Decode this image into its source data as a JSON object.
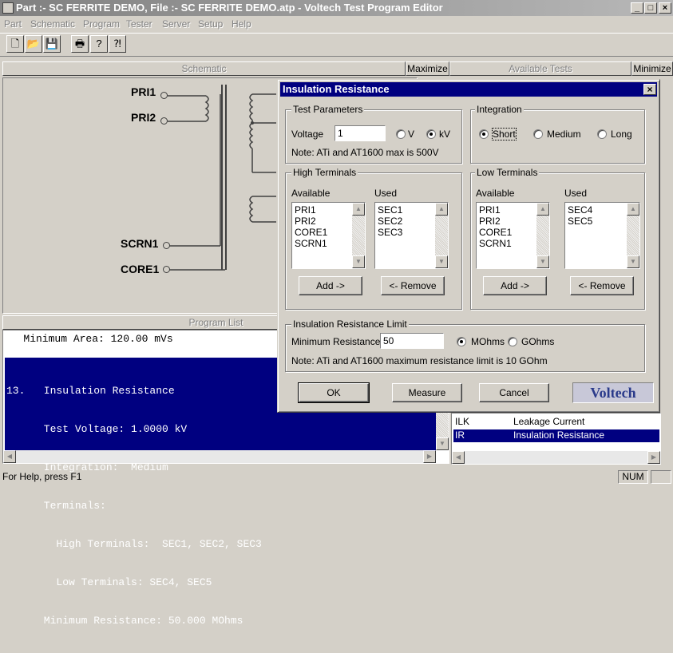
{
  "window": {
    "title": "Part :- SC FERRITE DEMO, File :- SC FERRITE DEMO.atp - Voltech Test Program Editor",
    "minimize": "_",
    "maximize": "□",
    "close": "×"
  },
  "menu": [
    "Part",
    "Schematic",
    "Program",
    "Tester",
    "Server",
    "Setup",
    "Help"
  ],
  "toolbar": {
    "new": "🗋",
    "open": "📂",
    "save": "💾",
    "print": "🖶",
    "help": "?",
    "context_help": "⁈"
  },
  "schematic_panel": {
    "title": "Schematic",
    "maximize": "Maximize"
  },
  "tests_panel": {
    "title": "Available Tests",
    "minimize": "Minimize"
  },
  "schematic": {
    "pins": [
      "PRI1",
      "PRI2",
      "SCRN1",
      "CORE1"
    ]
  },
  "program_list": {
    "title": "Program List",
    "top_line": "   Minimum Area: 120.00 mVs",
    "selected_lines": [
      "13.   Insulation Resistance",
      "      Test Voltage: 1.0000 kV",
      "      Integration:  Medium",
      "      Terminals:",
      "        High Terminals:  SEC1, SEC2, SEC3",
      "        Low Terminals: SEC4, SEC5",
      "      Minimum Resistance: 50.000 MOhms"
    ]
  },
  "available_tests": [
    {
      "code": "ILK",
      "name": "Leakage Current",
      "selected": false
    },
    {
      "code": "IR",
      "name": "Insulation Resistance",
      "selected": true
    }
  ],
  "dialog": {
    "title": "Insulation Resistance",
    "close": "×",
    "test_params": {
      "label": "Test Parameters",
      "voltage_label": "Voltage",
      "voltage_value": "1",
      "unit_v": "V",
      "unit_kv": "kV",
      "note": "Note: ATi and AT1600 max is 500V"
    },
    "integration": {
      "label": "Integration",
      "short": "Short",
      "medium": "Medium",
      "long": "Long"
    },
    "high": {
      "label": "High Terminals",
      "available_label": "Available",
      "used_label": "Used",
      "available": [
        "PRI1",
        "PRI2",
        "CORE1",
        "SCRN1"
      ],
      "used": [
        "SEC1",
        "SEC2",
        "SEC3"
      ],
      "add": "Add ->",
      "remove": "<- Remove"
    },
    "low": {
      "label": "Low Terminals",
      "available_label": "Available",
      "used_label": "Used",
      "available": [
        "PRI1",
        "PRI2",
        "CORE1",
        "SCRN1"
      ],
      "used": [
        "SEC4",
        "SEC5"
      ],
      "add": "Add ->",
      "remove": "<- Remove"
    },
    "limit": {
      "label": "Insulation Resistance Limit",
      "min_label": "Minimum Resistance",
      "min_value": "50",
      "mohms": "MOhms",
      "gohms": "GOhms",
      "note": "Note: ATi and AT1600 maximum resistance limit is 10 GOhm"
    },
    "ok": "OK",
    "measure": "Measure",
    "cancel": "Cancel",
    "logo": "Voltech"
  },
  "statusbar": {
    "text": "For Help, press F1",
    "num": "NUM"
  }
}
